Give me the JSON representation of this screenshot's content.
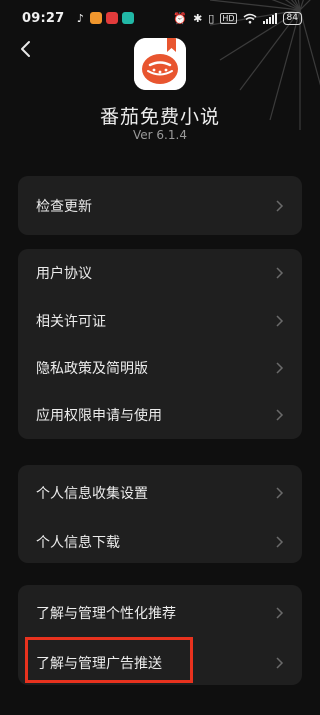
{
  "status_bar": {
    "time": "09:27",
    "battery": "84"
  },
  "header": {
    "app_name": "番茄免费小说",
    "version": "Ver 6.1.4"
  },
  "groups": [
    {
      "items": [
        {
          "label": "检查更新"
        }
      ]
    },
    {
      "items": [
        {
          "label": "用户协议"
        },
        {
          "label": "相关许可证"
        },
        {
          "label": "隐私政策及简明版"
        },
        {
          "label": "应用权限申请与使用"
        }
      ]
    },
    {
      "items": [
        {
          "label": "个人信息收集设置"
        },
        {
          "label": "个人信息下载"
        }
      ]
    },
    {
      "items": [
        {
          "label": "了解与管理个性化推荐"
        },
        {
          "label": "了解与管理广告推送"
        }
      ]
    }
  ],
  "colors": {
    "brand": "#e8552f",
    "highlight_box": "#e8321e"
  }
}
